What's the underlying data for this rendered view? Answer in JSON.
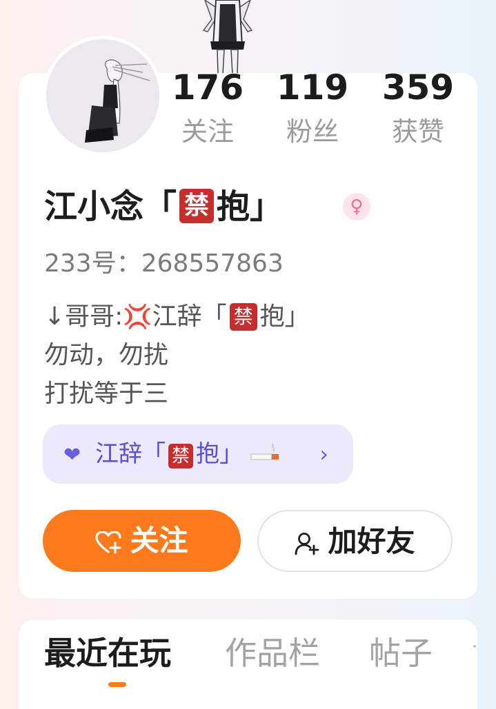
{
  "profile": {
    "name_text": "江小念「",
    "name_emoji": "禁",
    "name_suffix": "抱」",
    "gender_icon": "female-icon",
    "uid": "233号：268557863"
  },
  "stats": [
    {
      "value": "176",
      "label": "关注"
    },
    {
      "value": "119",
      "label": "粉丝"
    },
    {
      "value": "359",
      "label": "获赞"
    }
  ],
  "bio": {
    "line1_prefix": "↓哥哥:",
    "line1_anger": "💢",
    "line1_name": "江辞「",
    "line1_emoji": "禁",
    "line1_suffix": "抱」",
    "line2": "勿动，勿扰",
    "line3": "打扰等于三"
  },
  "cp_link": {
    "name_prefix": "江辞「",
    "name_emoji": "禁",
    "name_suffix": "抱」",
    "chevron": "›"
  },
  "actions": {
    "follow_label": "关注",
    "add_friend_label": "加好友"
  },
  "tabs": [
    "最近在玩",
    "作品栏",
    "帖子"
  ],
  "colors": {
    "accent": "#fc7a1c",
    "cp_bg": "#ebe9fb",
    "cp_text": "#5a4fd0",
    "gender_female": "#f06d8d"
  }
}
